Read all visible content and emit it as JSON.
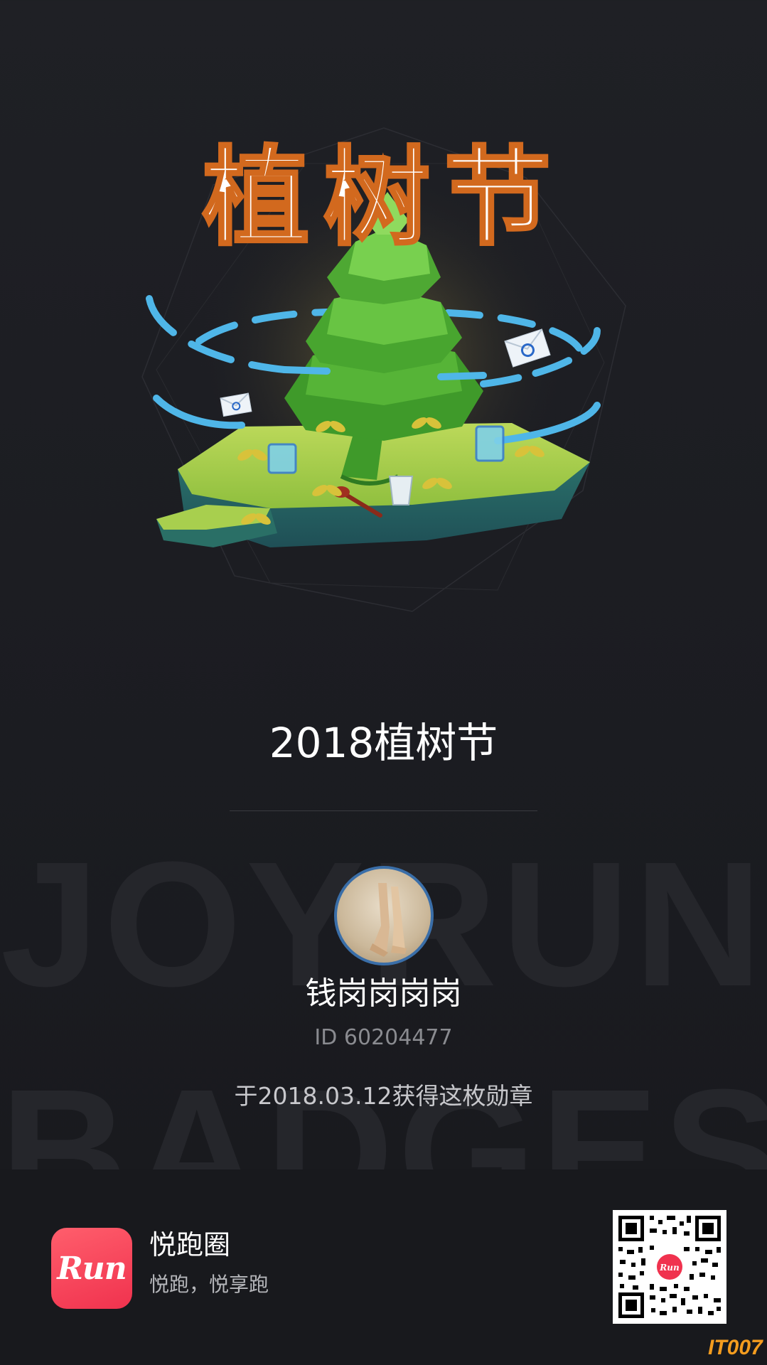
{
  "badge": {
    "art_text": "植树节",
    "title": "2018植树节"
  },
  "watermark": {
    "line1": "JOYRUN",
    "line2": "BADGES"
  },
  "user": {
    "name": "钱岗岗岗岗",
    "id": "ID 60204477",
    "earned_text": "于2018.03.12获得这枚勋章"
  },
  "footer": {
    "logo_text": "Run",
    "app_name": "悦跑圈",
    "slogan": "悦跑，悦享跑",
    "site_mark": "IT007"
  },
  "colors": {
    "background": "#1f2025",
    "avatar_ring": "#3a6ea8",
    "logo": "#f0324e",
    "tree": "#3f9a2a",
    "ring": "#4fb6e8",
    "site_mark": "#f39c1f"
  }
}
